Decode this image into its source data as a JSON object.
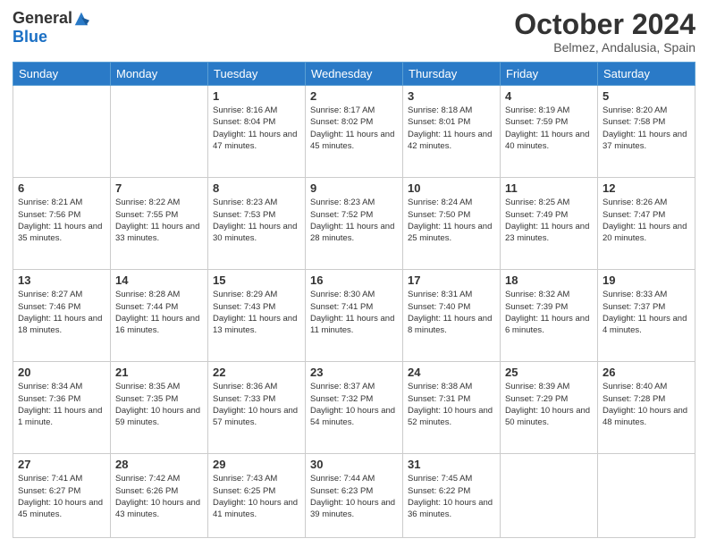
{
  "header": {
    "logo_general": "General",
    "logo_blue": "Blue",
    "month_title": "October 2024",
    "location": "Belmez, Andalusia, Spain"
  },
  "weekdays": [
    "Sunday",
    "Monday",
    "Tuesday",
    "Wednesday",
    "Thursday",
    "Friday",
    "Saturday"
  ],
  "weeks": [
    [
      {
        "day": "",
        "info": ""
      },
      {
        "day": "",
        "info": ""
      },
      {
        "day": "1",
        "info": "Sunrise: 8:16 AM\nSunset: 8:04 PM\nDaylight: 11 hours and 47 minutes."
      },
      {
        "day": "2",
        "info": "Sunrise: 8:17 AM\nSunset: 8:02 PM\nDaylight: 11 hours and 45 minutes."
      },
      {
        "day": "3",
        "info": "Sunrise: 8:18 AM\nSunset: 8:01 PM\nDaylight: 11 hours and 42 minutes."
      },
      {
        "day": "4",
        "info": "Sunrise: 8:19 AM\nSunset: 7:59 PM\nDaylight: 11 hours and 40 minutes."
      },
      {
        "day": "5",
        "info": "Sunrise: 8:20 AM\nSunset: 7:58 PM\nDaylight: 11 hours and 37 minutes."
      }
    ],
    [
      {
        "day": "6",
        "info": "Sunrise: 8:21 AM\nSunset: 7:56 PM\nDaylight: 11 hours and 35 minutes."
      },
      {
        "day": "7",
        "info": "Sunrise: 8:22 AM\nSunset: 7:55 PM\nDaylight: 11 hours and 33 minutes."
      },
      {
        "day": "8",
        "info": "Sunrise: 8:23 AM\nSunset: 7:53 PM\nDaylight: 11 hours and 30 minutes."
      },
      {
        "day": "9",
        "info": "Sunrise: 8:23 AM\nSunset: 7:52 PM\nDaylight: 11 hours and 28 minutes."
      },
      {
        "day": "10",
        "info": "Sunrise: 8:24 AM\nSunset: 7:50 PM\nDaylight: 11 hours and 25 minutes."
      },
      {
        "day": "11",
        "info": "Sunrise: 8:25 AM\nSunset: 7:49 PM\nDaylight: 11 hours and 23 minutes."
      },
      {
        "day": "12",
        "info": "Sunrise: 8:26 AM\nSunset: 7:47 PM\nDaylight: 11 hours and 20 minutes."
      }
    ],
    [
      {
        "day": "13",
        "info": "Sunrise: 8:27 AM\nSunset: 7:46 PM\nDaylight: 11 hours and 18 minutes."
      },
      {
        "day": "14",
        "info": "Sunrise: 8:28 AM\nSunset: 7:44 PM\nDaylight: 11 hours and 16 minutes."
      },
      {
        "day": "15",
        "info": "Sunrise: 8:29 AM\nSunset: 7:43 PM\nDaylight: 11 hours and 13 minutes."
      },
      {
        "day": "16",
        "info": "Sunrise: 8:30 AM\nSunset: 7:41 PM\nDaylight: 11 hours and 11 minutes."
      },
      {
        "day": "17",
        "info": "Sunrise: 8:31 AM\nSunset: 7:40 PM\nDaylight: 11 hours and 8 minutes."
      },
      {
        "day": "18",
        "info": "Sunrise: 8:32 AM\nSunset: 7:39 PM\nDaylight: 11 hours and 6 minutes."
      },
      {
        "day": "19",
        "info": "Sunrise: 8:33 AM\nSunset: 7:37 PM\nDaylight: 11 hours and 4 minutes."
      }
    ],
    [
      {
        "day": "20",
        "info": "Sunrise: 8:34 AM\nSunset: 7:36 PM\nDaylight: 11 hours and 1 minute."
      },
      {
        "day": "21",
        "info": "Sunrise: 8:35 AM\nSunset: 7:35 PM\nDaylight: 10 hours and 59 minutes."
      },
      {
        "day": "22",
        "info": "Sunrise: 8:36 AM\nSunset: 7:33 PM\nDaylight: 10 hours and 57 minutes."
      },
      {
        "day": "23",
        "info": "Sunrise: 8:37 AM\nSunset: 7:32 PM\nDaylight: 10 hours and 54 minutes."
      },
      {
        "day": "24",
        "info": "Sunrise: 8:38 AM\nSunset: 7:31 PM\nDaylight: 10 hours and 52 minutes."
      },
      {
        "day": "25",
        "info": "Sunrise: 8:39 AM\nSunset: 7:29 PM\nDaylight: 10 hours and 50 minutes."
      },
      {
        "day": "26",
        "info": "Sunrise: 8:40 AM\nSunset: 7:28 PM\nDaylight: 10 hours and 48 minutes."
      }
    ],
    [
      {
        "day": "27",
        "info": "Sunrise: 7:41 AM\nSunset: 6:27 PM\nDaylight: 10 hours and 45 minutes."
      },
      {
        "day": "28",
        "info": "Sunrise: 7:42 AM\nSunset: 6:26 PM\nDaylight: 10 hours and 43 minutes."
      },
      {
        "day": "29",
        "info": "Sunrise: 7:43 AM\nSunset: 6:25 PM\nDaylight: 10 hours and 41 minutes."
      },
      {
        "day": "30",
        "info": "Sunrise: 7:44 AM\nSunset: 6:23 PM\nDaylight: 10 hours and 39 minutes."
      },
      {
        "day": "31",
        "info": "Sunrise: 7:45 AM\nSunset: 6:22 PM\nDaylight: 10 hours and 36 minutes."
      },
      {
        "day": "",
        "info": ""
      },
      {
        "day": "",
        "info": ""
      }
    ]
  ]
}
